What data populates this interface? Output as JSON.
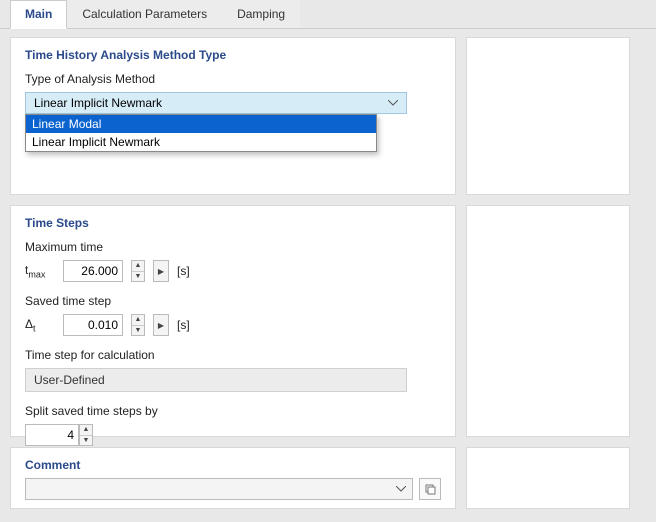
{
  "tabs": {
    "main": "Main",
    "calc_params": "Calculation Parameters",
    "damping": "Damping"
  },
  "method_section": {
    "title": "Time History Analysis Method Type",
    "label": "Type of Analysis Method",
    "selected": "Linear Implicit Newmark",
    "options": {
      "opt1": "Linear Modal",
      "opt2": "Linear Implicit Newmark"
    }
  },
  "time_steps": {
    "title": "Time Steps",
    "max_time_label": "Maximum time",
    "max_time_symbol": "t",
    "max_time_sub": "max",
    "max_time_value": "26.000",
    "max_time_unit": "[s]",
    "saved_step_label": "Saved time step",
    "saved_step_symbol": "Δ",
    "saved_step_sub": "t",
    "saved_step_value": "0.010",
    "saved_step_unit": "[s]",
    "calc_step_label": "Time step for calculation",
    "calc_step_value": "User-Defined",
    "split_label": "Split saved time steps by",
    "split_value": "4"
  },
  "comment": {
    "title": "Comment"
  }
}
